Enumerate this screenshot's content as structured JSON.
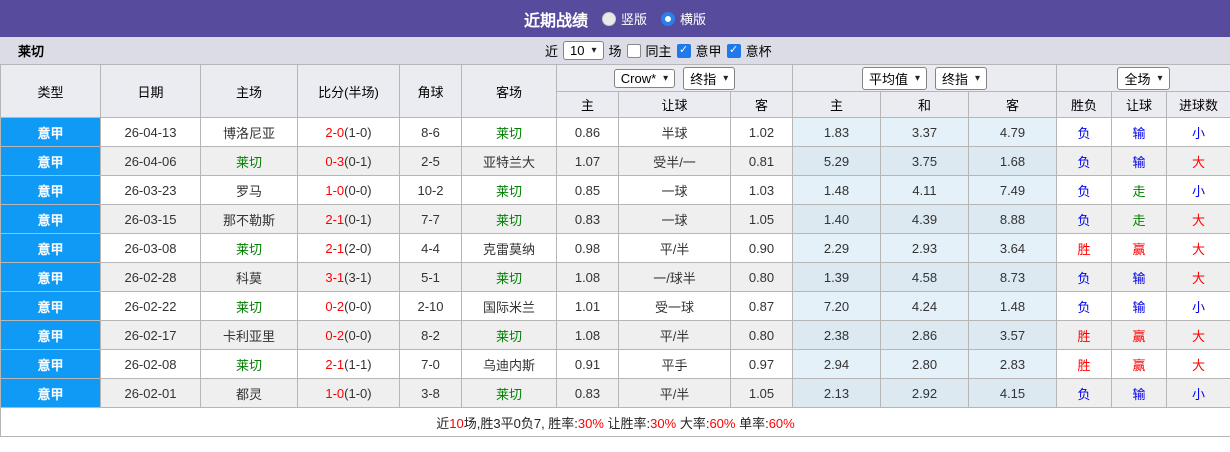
{
  "meta": {
    "focus_team": "莱切",
    "focus_team_color": "#008000",
    "accent_purple": "#574b9e",
    "league_blue": "#0f9af5"
  },
  "titlebar": {
    "title": "近期战绩",
    "radios": [
      {
        "label": "竖版",
        "selected": false
      },
      {
        "label": "横版",
        "selected": true
      }
    ]
  },
  "filterbar": {
    "team": "莱切",
    "recent_prefix": "近",
    "recent_count": "10",
    "recent_suffix": "场",
    "checkboxes": [
      {
        "label": "同主",
        "checked": false
      },
      {
        "label": "意甲",
        "checked": true
      },
      {
        "label": "意杯",
        "checked": true
      }
    ]
  },
  "table": {
    "headers": {
      "type": "类型",
      "date": "日期",
      "home": "主场",
      "score": "比分(半场)",
      "corner": "角球",
      "away": "客场",
      "sub": [
        "主",
        "让球",
        "客",
        "主",
        "和",
        "客",
        "胜负",
        "让球",
        "进球数"
      ],
      "selects": {
        "company": "Crow*",
        "final1": "终指",
        "average": "平均值",
        "final2": "终指",
        "fulltime": "全场"
      }
    },
    "value_colors": {
      "胜": "#ff0000",
      "负": "#0000ee",
      "赢": "#ff0000",
      "输": "#0000ee",
      "走": "#008000",
      "大": "#ff0000",
      "小": "#0000ee"
    },
    "rows": [
      {
        "league": "意甲",
        "date": "26-04-13",
        "home": "博洛尼亚",
        "score": "2-0",
        "half": "(1-0)",
        "corner": "8-6",
        "away": "莱切",
        "odds_home": "0.86",
        "handicap": "半球",
        "odds_away": "1.02",
        "avg_home": "1.83",
        "avg_draw": "3.37",
        "avg_away": "4.79",
        "result_wdl": "负",
        "result_handicap": "输",
        "result_goals": "小"
      },
      {
        "league": "意甲",
        "date": "26-04-06",
        "home": "莱切",
        "score": "0-3",
        "half": "(0-1)",
        "corner": "2-5",
        "away": "亚特兰大",
        "odds_home": "1.07",
        "handicap": "受半/一",
        "odds_away": "0.81",
        "avg_home": "5.29",
        "avg_draw": "3.75",
        "avg_away": "1.68",
        "result_wdl": "负",
        "result_handicap": "输",
        "result_goals": "大"
      },
      {
        "league": "意甲",
        "date": "26-03-23",
        "home": "罗马",
        "score": "1-0",
        "half": "(0-0)",
        "corner": "10-2",
        "away": "莱切",
        "odds_home": "0.85",
        "handicap": "一球",
        "odds_away": "1.03",
        "avg_home": "1.48",
        "avg_draw": "4.11",
        "avg_away": "7.49",
        "result_wdl": "负",
        "result_handicap": "走",
        "result_goals": "小"
      },
      {
        "league": "意甲",
        "date": "26-03-15",
        "home": "那不勒斯",
        "score": "2-1",
        "half": "(0-1)",
        "corner": "7-7",
        "away": "莱切",
        "odds_home": "0.83",
        "handicap": "一球",
        "odds_away": "1.05",
        "avg_home": "1.40",
        "avg_draw": "4.39",
        "avg_away": "8.88",
        "result_wdl": "负",
        "result_handicap": "走",
        "result_goals": "大"
      },
      {
        "league": "意甲",
        "date": "26-03-08",
        "home": "莱切",
        "score": "2-1",
        "half": "(2-0)",
        "corner": "4-4",
        "away": "克雷莫纳",
        "odds_home": "0.98",
        "handicap": "平/半",
        "odds_away": "0.90",
        "avg_home": "2.29",
        "avg_draw": "2.93",
        "avg_away": "3.64",
        "result_wdl": "胜",
        "result_handicap": "赢",
        "result_goals": "大"
      },
      {
        "league": "意甲",
        "date": "26-02-28",
        "home": "科莫",
        "score": "3-1",
        "half": "(3-1)",
        "corner": "5-1",
        "away": "莱切",
        "odds_home": "1.08",
        "handicap": "一/球半",
        "odds_away": "0.80",
        "avg_home": "1.39",
        "avg_draw": "4.58",
        "avg_away": "8.73",
        "result_wdl": "负",
        "result_handicap": "输",
        "result_goals": "大"
      },
      {
        "league": "意甲",
        "date": "26-02-22",
        "home": "莱切",
        "score": "0-2",
        "half": "(0-0)",
        "corner": "2-10",
        "away": "国际米兰",
        "odds_home": "1.01",
        "handicap": "受一球",
        "odds_away": "0.87",
        "avg_home": "7.20",
        "avg_draw": "4.24",
        "avg_away": "1.48",
        "result_wdl": "负",
        "result_handicap": "输",
        "result_goals": "小"
      },
      {
        "league": "意甲",
        "date": "26-02-17",
        "home": "卡利亚里",
        "score": "0-2",
        "half": "(0-0)",
        "corner": "8-2",
        "away": "莱切",
        "odds_home": "1.08",
        "handicap": "平/半",
        "odds_away": "0.80",
        "avg_home": "2.38",
        "avg_draw": "2.86",
        "avg_away": "3.57",
        "result_wdl": "胜",
        "result_handicap": "赢",
        "result_goals": "大"
      },
      {
        "league": "意甲",
        "date": "26-02-08",
        "home": "莱切",
        "score": "2-1",
        "half": "(1-1)",
        "corner": "7-0",
        "away": "乌迪内斯",
        "odds_home": "0.91",
        "handicap": "平手",
        "odds_away": "0.97",
        "avg_home": "2.94",
        "avg_draw": "2.80",
        "avg_away": "2.83",
        "result_wdl": "胜",
        "result_handicap": "赢",
        "result_goals": "大"
      },
      {
        "league": "意甲",
        "date": "26-02-01",
        "home": "都灵",
        "score": "1-0",
        "half": "(1-0)",
        "corner": "3-8",
        "away": "莱切",
        "odds_home": "0.83",
        "handicap": "平/半",
        "odds_away": "1.05",
        "avg_home": "2.13",
        "avg_draw": "2.92",
        "avg_away": "4.15",
        "result_wdl": "负",
        "result_handicap": "输",
        "result_goals": "小"
      }
    ]
  },
  "summary": {
    "parts": [
      {
        "text": "近",
        "red": false
      },
      {
        "text": "10",
        "red": true
      },
      {
        "text": "场,胜3平0负7, 胜率:",
        "red": false
      },
      {
        "text": "30%",
        "red": true
      },
      {
        "text": " 让胜率:",
        "red": false
      },
      {
        "text": "30%",
        "red": true
      },
      {
        "text": " 大率:",
        "red": false
      },
      {
        "text": "60%",
        "red": true
      },
      {
        "text": " 单率:",
        "red": false
      },
      {
        "text": "60%",
        "red": true
      }
    ]
  }
}
